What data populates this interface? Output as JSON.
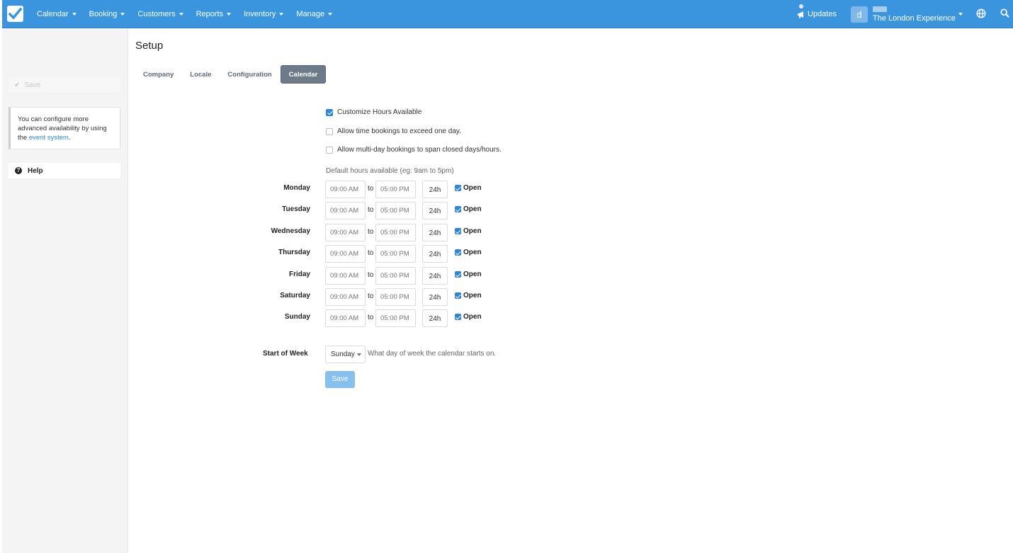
{
  "nav": {
    "items": [
      {
        "label": "Calendar"
      },
      {
        "label": "Booking"
      },
      {
        "label": "Customers"
      },
      {
        "label": "Reports"
      },
      {
        "label": "Inventory"
      },
      {
        "label": "Manage"
      }
    ],
    "updates_label": "Updates",
    "avatar_letter": "d",
    "account_name": "The London Experience",
    "brand_color": "#3b95de"
  },
  "sidebar": {
    "save_label": "Save",
    "note_text": "You can configure more advanced availability by using the ",
    "note_link": "event system",
    "note_end": ".",
    "help_label": "Help"
  },
  "page": {
    "title": "Setup",
    "tabs": [
      {
        "label": "Company",
        "active": false
      },
      {
        "label": "Locale",
        "active": false
      },
      {
        "label": "Configuration",
        "active": false
      },
      {
        "label": "Calendar",
        "active": true
      }
    ]
  },
  "options": [
    {
      "label": "Customize Hours Available",
      "checked": true
    },
    {
      "label": "Allow time bookings to exceed one day.",
      "checked": false
    },
    {
      "label": "Allow multi-day bookings to span closed days/hours.",
      "checked": false
    }
  ],
  "hours_hint": "Default hours available (eg: 9am to 5pm)",
  "to_label": "to",
  "h24_label": "24h",
  "open_label": "Open",
  "days": [
    {
      "name": "Monday",
      "from": "09:00 AM",
      "to": "05:00 PM",
      "open": true
    },
    {
      "name": "Tuesday",
      "from": "09:00 AM",
      "to": "05:00 PM",
      "open": true
    },
    {
      "name": "Wednesday",
      "from": "09:00 AM",
      "to": "05:00 PM",
      "open": true
    },
    {
      "name": "Thursday",
      "from": "09:00 AM",
      "to": "05:00 PM",
      "open": true
    },
    {
      "name": "Friday",
      "from": "09:00 AM",
      "to": "05:00 PM",
      "open": true
    },
    {
      "name": "Saturday",
      "from": "09:00 AM",
      "to": "05:00 PM",
      "open": true
    },
    {
      "name": "Sunday",
      "from": "09:00 AM",
      "to": "05:00 PM",
      "open": true
    }
  ],
  "start_of_week": {
    "label": "Start of Week",
    "value": "Sunday",
    "help": "What day of week the calendar starts on."
  },
  "save_label": "Save"
}
